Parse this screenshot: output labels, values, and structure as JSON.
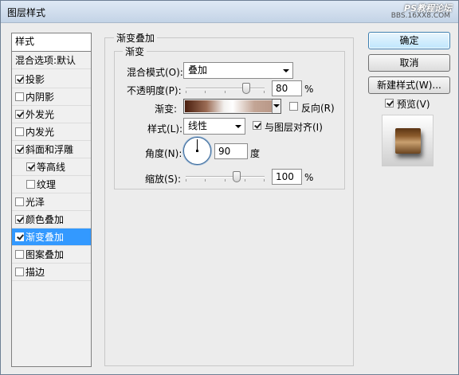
{
  "window": {
    "title": "图层样式",
    "watermark_top": "PS教程论坛",
    "watermark_bottom": "BBS.16XX8.COM"
  },
  "sidebar": {
    "header": "样式",
    "blend_options": "混合选项:默认",
    "items": [
      {
        "label": "投影",
        "checked": true
      },
      {
        "label": "内阴影",
        "checked": false
      },
      {
        "label": "外发光",
        "checked": true
      },
      {
        "label": "内发光",
        "checked": false
      },
      {
        "label": "斜面和浮雕",
        "checked": true
      },
      {
        "label": "等高线",
        "checked": true
      },
      {
        "label": "纹理",
        "checked": false
      },
      {
        "label": "光泽",
        "checked": false
      },
      {
        "label": "颜色叠加",
        "checked": true
      },
      {
        "label": "渐变叠加",
        "checked": true,
        "selected": true
      },
      {
        "label": "图案叠加",
        "checked": false
      },
      {
        "label": "描边",
        "checked": false
      }
    ]
  },
  "gradient_overlay": {
    "group_title": "渐变叠加",
    "subgroup_title": "渐变",
    "blend_mode_label": "混合模式(O):",
    "blend_mode_value": "叠加",
    "opacity_label": "不透明度(P):",
    "opacity_value": "80",
    "opacity_unit": "%",
    "opacity_level": 0.8,
    "gradient_label": "渐变:",
    "gradient_colors": [
      "#4a1e0e",
      "#9b6c55",
      "#f2f0ee",
      "#ffffff",
      "#c3a595",
      "#b99888"
    ],
    "reverse_label": "反向(R)",
    "reverse_checked": false,
    "style_label": "样式(L):",
    "style_value": "线性",
    "align_label": "与图层对齐(I)",
    "align_checked": true,
    "angle_label": "角度(N):",
    "angle_value": "90",
    "angle_unit": "度",
    "scale_label": "缩放(S):",
    "scale_value": "100",
    "scale_unit": "%",
    "scale_level": 0.6667
  },
  "buttons": {
    "ok": "确定",
    "cancel": "取消",
    "new_style": "新建样式(W)..."
  },
  "preview": {
    "label": "预览(V)",
    "checked": true,
    "swatch_color": "#8a5a2c"
  }
}
